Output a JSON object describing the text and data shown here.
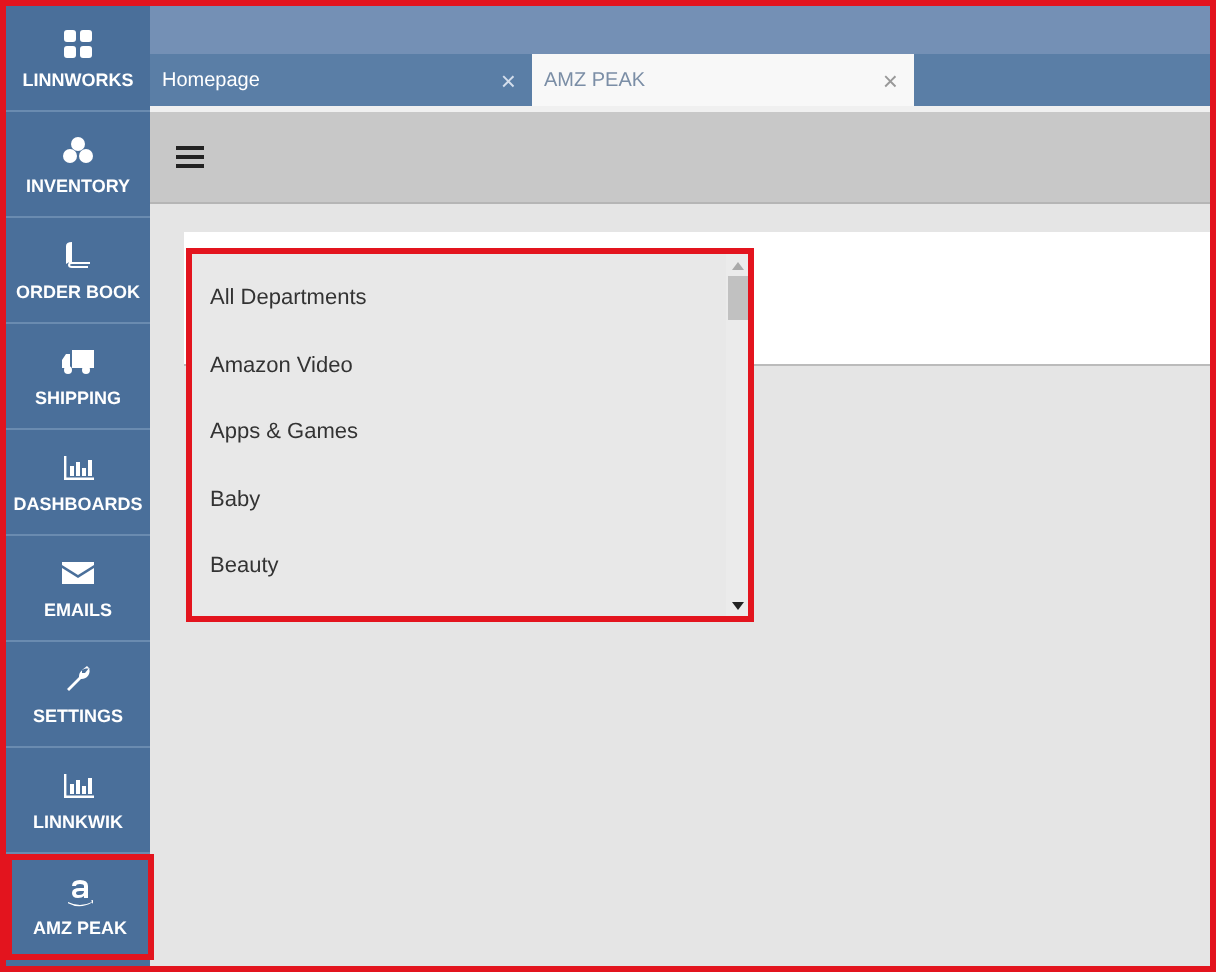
{
  "sidebar": {
    "items": [
      {
        "label": "LINNWORKS",
        "highlighted": false
      },
      {
        "label": "INVENTORY",
        "highlighted": false
      },
      {
        "label": "ORDER BOOK",
        "highlighted": false
      },
      {
        "label": "SHIPPING",
        "highlighted": false
      },
      {
        "label": "DASHBOARDS",
        "highlighted": false
      },
      {
        "label": "EMAILS",
        "highlighted": false
      },
      {
        "label": "SETTINGS",
        "highlighted": false
      },
      {
        "label": "LINNKWIK",
        "highlighted": false
      },
      {
        "label": "AMZ PEAK",
        "highlighted": true
      }
    ]
  },
  "tabs": [
    {
      "label": "Homepage",
      "close": "×",
      "selected": false
    },
    {
      "label": "AMZ PEAK",
      "close": "×",
      "selected": true
    }
  ],
  "dropdown": {
    "highlighted": true,
    "options": [
      "All Departments",
      "Amazon Video",
      "Apps & Games",
      "Baby",
      "Beauty"
    ]
  }
}
